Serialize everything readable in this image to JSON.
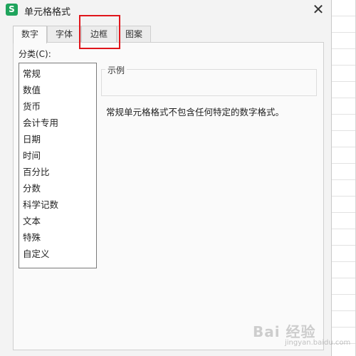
{
  "window": {
    "title": "单元格格式",
    "app_icon": "S",
    "close_symbol": "✕"
  },
  "tabs": [
    {
      "label": "数字",
      "active": true
    },
    {
      "label": "字体",
      "active": false
    },
    {
      "label": "边框",
      "active": false,
      "highlighted": true
    },
    {
      "label": "图案",
      "active": false
    }
  ],
  "number_tab": {
    "category_label": "分类(C):",
    "categories": [
      "常规",
      "数值",
      "货币",
      "会计专用",
      "日期",
      "时间",
      "百分比",
      "分数",
      "科学记数",
      "文本",
      "特殊",
      "自定义"
    ],
    "selected_category": "常规",
    "sample_label": "示例",
    "sample_value": "",
    "description": "常规单元格格式不包含任何特定的数字格式。"
  },
  "watermark": {
    "text": "Bai 经验",
    "sub": "jingyan.baidu.com"
  },
  "colors": {
    "highlight": "#e0151b",
    "app_icon_bg": "#1fa45c"
  }
}
